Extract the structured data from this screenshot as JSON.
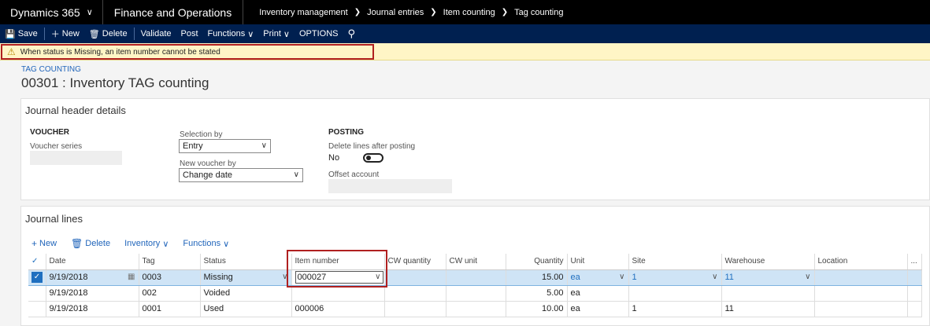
{
  "topbar": {
    "brand": "Dynamics 365",
    "module": "Finance and Operations",
    "breadcrumb": [
      "Inventory management",
      "Journal entries",
      "Item counting",
      "Tag counting"
    ]
  },
  "actionbar": {
    "save": "Save",
    "new": "New",
    "delete": "Delete",
    "validate": "Validate",
    "post": "Post",
    "functions": "Functions",
    "print": "Print",
    "options": "OPTIONS"
  },
  "message": "When status is Missing, an item number cannot be stated",
  "page": {
    "subtitle": "TAG COUNTING",
    "title": "00301 : Inventory TAG counting"
  },
  "header_details": {
    "title": "Journal header details",
    "voucher_group": "VOUCHER",
    "voucher_series_label": "Voucher series",
    "voucher_series_value": "",
    "selection_by_label": "Selection by",
    "selection_by_value": "Entry",
    "new_voucher_by_label": "New voucher by",
    "new_voucher_by_value": "Change date",
    "posting_group": "POSTING",
    "delete_lines_label": "Delete lines after posting",
    "delete_lines_value": "No",
    "offset_account_label": "Offset account",
    "offset_account_value": ""
  },
  "journal_lines": {
    "title": "Journal lines",
    "actions": {
      "new": "New",
      "delete": "Delete",
      "inventory": "Inventory",
      "functions": "Functions"
    },
    "columns": [
      "Date",
      "Tag",
      "Status",
      "Item number",
      "CW quantity",
      "CW unit",
      "Quantity",
      "Unit",
      "Site",
      "Warehouse",
      "Location",
      "..."
    ],
    "rows": [
      {
        "date": "9/19/2018",
        "tag": "0003",
        "status": "Missing",
        "item": "000027",
        "cw_qty": "",
        "cw_unit": "",
        "qty": "15.00",
        "unit": "ea",
        "site": "1",
        "warehouse": "11",
        "location": "",
        "selected": true
      },
      {
        "date": "9/19/2018",
        "tag": "002",
        "status": "Voided",
        "item": "",
        "cw_qty": "",
        "cw_unit": "",
        "qty": "5.00",
        "unit": "ea",
        "site": "",
        "warehouse": "",
        "location": "",
        "selected": false
      },
      {
        "date": "9/19/2018",
        "tag": "0001",
        "status": "Used",
        "item": "000006",
        "cw_qty": "",
        "cw_unit": "",
        "qty": "10.00",
        "unit": "ea",
        "site": "1",
        "warehouse": "11",
        "location": "",
        "selected": false
      }
    ]
  },
  "colors": {
    "topbar": "#000000",
    "actionbar": "#002050",
    "message_bg": "#fff5c6",
    "highlight_box": "#b02020",
    "selected_row": "#cfe4f6",
    "link": "#2266bb"
  }
}
